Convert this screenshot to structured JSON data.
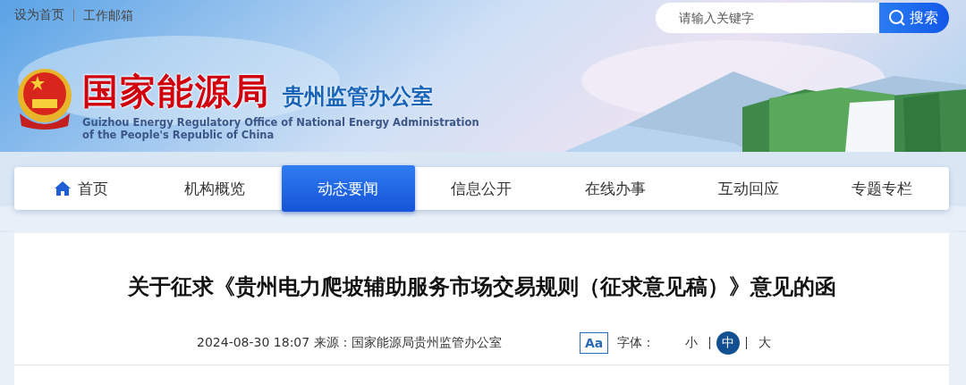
{
  "top_links": [
    "设为首页",
    "工作邮箱"
  ],
  "search": {
    "placeholder": "请输入关键字",
    "button": "搜索"
  },
  "header": {
    "title": "国家能源局",
    "subtitle": "贵州监管办公室",
    "english": [
      "Guizhou Energy Regulatory Office of National Energy Administration",
      "of the People's Republic of China"
    ]
  },
  "nav": [
    {
      "label": "首页",
      "kind": "home",
      "selected": false
    },
    {
      "label": "机构概览",
      "kind": "plain",
      "selected": false
    },
    {
      "label": "动态要闻",
      "kind": "plain",
      "selected": true
    },
    {
      "label": "信息公开",
      "kind": "plain",
      "selected": false
    },
    {
      "label": "在线办事",
      "kind": "plain",
      "selected": false
    },
    {
      "label": "互动回应",
      "kind": "plain",
      "selected": false
    },
    {
      "label": "专题专栏",
      "kind": "plain",
      "selected": false
    }
  ],
  "article": {
    "title": "关于征求《贵州电力爬坡辅助服务市场交易规则（征求意见稿）》意见的函",
    "datetime": "2024-08-30 18:07",
    "source_label": "来源：",
    "source": "国家能源局贵州监管办公室",
    "font_badge": "Aa",
    "font_label": "字体：",
    "font_sizes": [
      {
        "label": "小",
        "selected": false
      },
      {
        "label": "中",
        "selected": true
      },
      {
        "label": "大",
        "selected": false
      }
    ]
  }
}
